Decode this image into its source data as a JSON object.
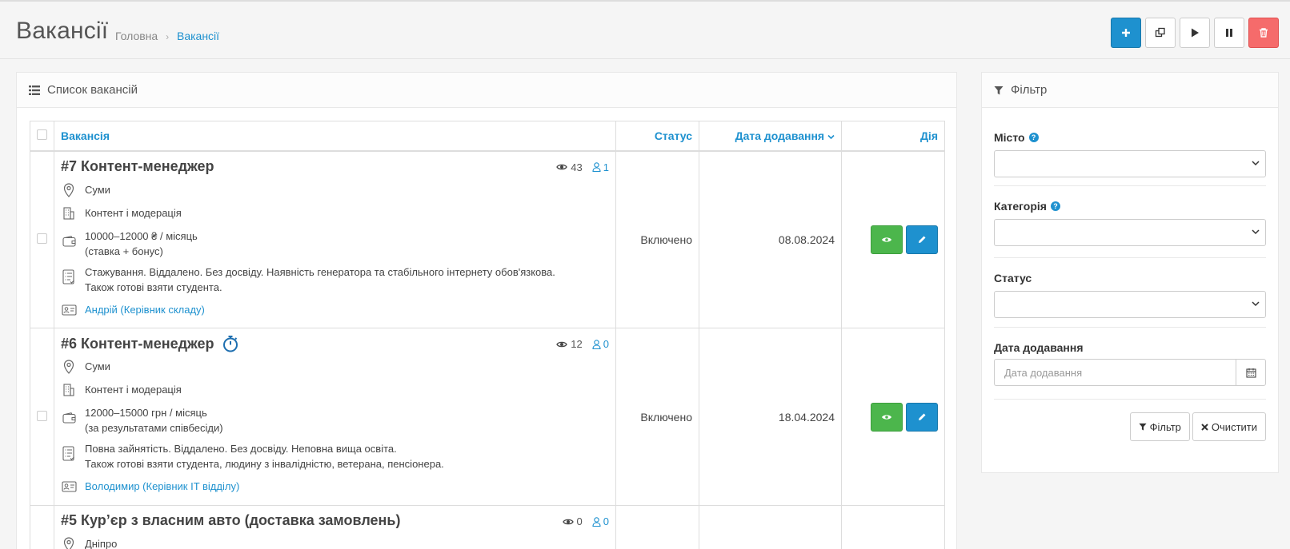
{
  "header": {
    "title": "Вакансії",
    "breadcrumb": {
      "home": "Головна",
      "separator": "›",
      "current": "Вакансії"
    }
  },
  "toolbar": {
    "buttons": [
      {
        "name": "add",
        "icon": "plus-icon"
      },
      {
        "name": "copy",
        "icon": "copy-icon"
      },
      {
        "name": "enable",
        "icon": "play-icon"
      },
      {
        "name": "disable",
        "icon": "pause-icon"
      },
      {
        "name": "delete",
        "icon": "trash-icon"
      }
    ]
  },
  "list": {
    "heading": "Список вакансій",
    "columns": {
      "vacancy": "Вакансія",
      "status": "Статус",
      "date": "Дата додавання",
      "action": "Дія"
    },
    "rows": [
      {
        "title": "#7 Контент-менеджер",
        "views": "43",
        "candidates": "1",
        "city": "Суми",
        "category": "Контент і модерація",
        "salary": "10000–12000 ₴ / місяць",
        "salary_note": "(ставка + бонус)",
        "requirements": "Стажування. Віддалено. Без досвіду. Наявність генератора та стабільного інтернету обов'язкова.",
        "requirements2": "Також готові взяти студента.",
        "contact": "Андрій (Керівник складу)",
        "status": "Включено",
        "date": "08.08.2024"
      },
      {
        "title": "#6 Контент-менеджер",
        "views": "12",
        "candidates": "0",
        "city": "Суми",
        "category": "Контент і модерація",
        "salary": "12000–15000 грн / місяць",
        "salary_note": "(за результатами співбесіди)",
        "requirements": "Повна зайнятість. Віддалено. Без досвіду. Неповна вища освіта.",
        "requirements2": "Також готові взяти студента, людину з інвалідністю, ветерана, пенсіонера.",
        "contact": "Володимир (Керівник IT відділу)",
        "status": "Включено",
        "date": "18.04.2024"
      },
      {
        "title": "#5 Кур’єр з власним авто (доставка замовлень)",
        "views": "0",
        "candidates": "0",
        "city": "Дніпро"
      }
    ]
  },
  "filter": {
    "heading": "Фільтр",
    "city_label": "Місто",
    "category_label": "Категорія",
    "status_label": "Статус",
    "date_label": "Дата додавання",
    "date_placeholder": "Дата додавання",
    "filter_button": "Фільтр",
    "clear_button": "Очистити"
  },
  "colors": {
    "accent": "#1e91cf",
    "success": "#4cb64c",
    "danger": "#f56b6b"
  }
}
